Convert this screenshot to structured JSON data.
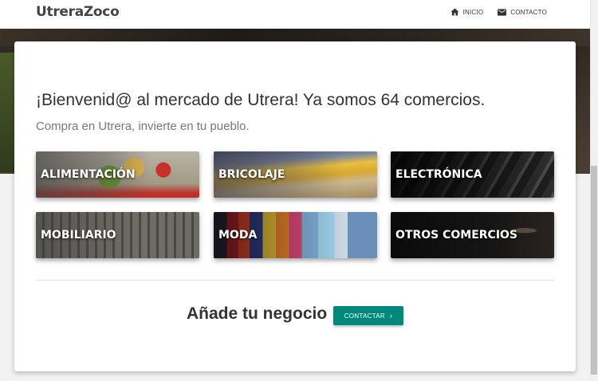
{
  "header": {
    "brand": "UtreraZoco",
    "nav": [
      {
        "label": "INICIO",
        "icon": "home-icon"
      },
      {
        "label": "CONTACTO",
        "icon": "mail-icon"
      }
    ]
  },
  "main": {
    "welcome_title": "¡Bienvenid@ al mercado de Utrera! Ya somos 64 comercios.",
    "subtitle": "Compra en Utrera, invierte en tu pueblo.",
    "categories": [
      {
        "label": "ALIMENTACIÓN"
      },
      {
        "label": "BRICOLAJE"
      },
      {
        "label": "ELECTRÓNICA"
      },
      {
        "label": "MOBILIARIO"
      },
      {
        "label": "MODA"
      },
      {
        "label": "OTROS COMERCIOS"
      }
    ],
    "add_business_text": "Añade tu negocio",
    "contact_button_label": "CONTACTAR",
    "contact_button_icon": "chevron-right-icon"
  },
  "colors": {
    "accent": "#00897b",
    "header_bg": "#ffffff",
    "text_primary": "#333333",
    "text_secondary": "#777777"
  }
}
